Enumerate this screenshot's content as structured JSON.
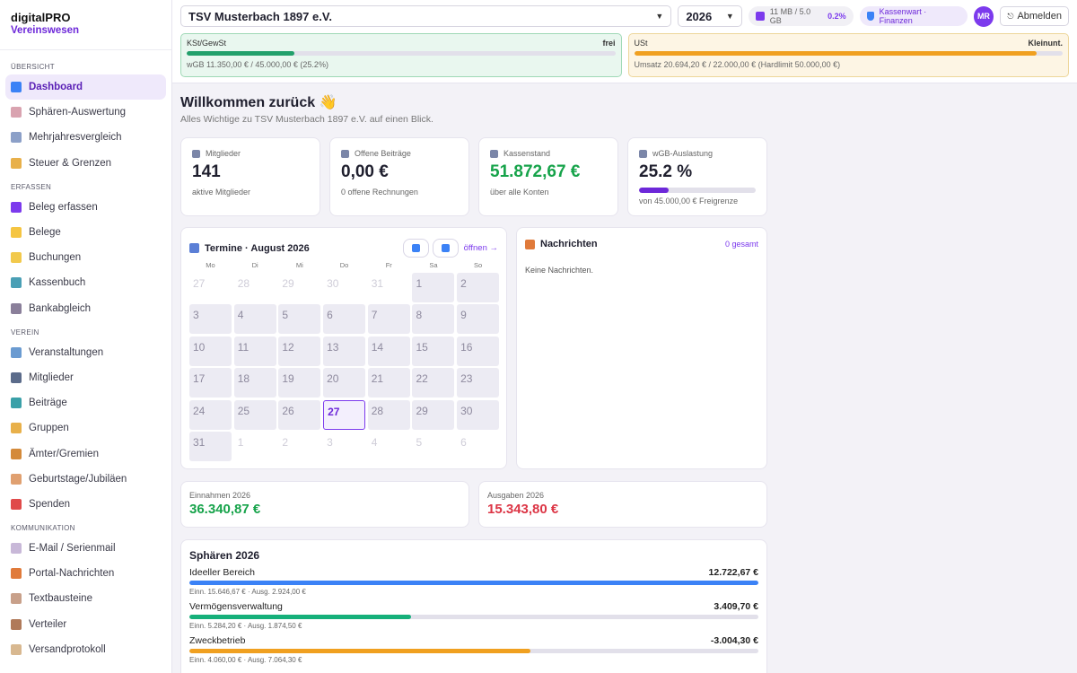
{
  "brand": {
    "name": "digitalPRO",
    "sub": "Vereinswesen"
  },
  "sidebar": {
    "sections": [
      {
        "label": "Übersicht",
        "items": [
          {
            "label": "Dashboard",
            "icon": "bar-chart-icon",
            "color": "#3b82f6",
            "active": true
          },
          {
            "label": "Sphären-Auswertung",
            "icon": "document-icon",
            "color": "#d9a3b0"
          },
          {
            "label": "Mehrjahresvergleich",
            "icon": "trend-icon",
            "color": "#8ca0c8"
          },
          {
            "label": "Steuer & Grenzen",
            "icon": "scale-icon",
            "color": "#e8b04a"
          }
        ]
      },
      {
        "label": "Erfassen",
        "items": [
          {
            "label": "Beleg erfassen",
            "icon": "plus-icon",
            "color": "#7c3aed"
          },
          {
            "label": "Belege",
            "icon": "folder-icon",
            "color": "#f5c542"
          },
          {
            "label": "Buchungen",
            "icon": "ledger-icon",
            "color": "#f2c94c"
          },
          {
            "label": "Kassenbuch",
            "icon": "cash-icon",
            "color": "#4a9fb5"
          },
          {
            "label": "Bankabgleich",
            "icon": "bank-icon",
            "color": "#8a7f9a"
          }
        ]
      },
      {
        "label": "Verein",
        "items": [
          {
            "label": "Veranstaltungen",
            "icon": "party-icon",
            "color": "#6b9bd1"
          },
          {
            "label": "Mitglieder",
            "icon": "members-icon",
            "color": "#5b6b8a"
          },
          {
            "label": "Beiträge",
            "icon": "money-icon",
            "color": "#3aa0a8"
          },
          {
            "label": "Gruppen",
            "icon": "tag-icon",
            "color": "#e8b04a"
          },
          {
            "label": "Ämter/Gremien",
            "icon": "medal-icon",
            "color": "#d48a3a"
          },
          {
            "label": "Geburtstage/Jubiläen",
            "icon": "cake-icon",
            "color": "#e0a070"
          },
          {
            "label": "Spenden",
            "icon": "gift-icon",
            "color": "#e04a4a"
          }
        ]
      },
      {
        "label": "Kommunikation",
        "items": [
          {
            "label": "E-Mail / Serienmail",
            "icon": "mail-icon",
            "color": "#c8b8d8"
          },
          {
            "label": "Portal-Nachrichten",
            "icon": "megaphone-icon",
            "color": "#e07a3a"
          },
          {
            "label": "Textbausteine",
            "icon": "memo-icon",
            "color": "#c8a08a"
          },
          {
            "label": "Verteiler",
            "icon": "clipboard-icon",
            "color": "#b07a5a"
          },
          {
            "label": "Versandprotokoll",
            "icon": "scroll-icon",
            "color": "#d8b890"
          }
        ]
      }
    ]
  },
  "topbar": {
    "club": "TSV Musterbach 1897 e.V.",
    "year": "2026",
    "storage": "11 MB / 5.0 GB",
    "storage_pct": "0.2%",
    "role": "Kassenwart · Finanzen",
    "avatar": "MR",
    "logout": "Abmelden"
  },
  "limits": [
    {
      "name": "KSt/GewSt",
      "status": "frei",
      "detail": "wGB 11.350,00 € / 45.000,00 € (25.2%)",
      "fraction": 0.252,
      "color": "#22a06b"
    },
    {
      "name": "USt",
      "status": "Kleinunt.",
      "detail": "Umsatz 20.694,20 € / 22.000,00 € (Hardlimit 50.000,00 €)",
      "fraction": 0.94,
      "color": "#f0a020"
    }
  ],
  "welcome": {
    "title": "Willkommen zurück 👋",
    "sub": "Alles Wichtige zu TSV Musterbach 1897 e.V. auf einen Blick."
  },
  "kpis": [
    {
      "label": "Mitglieder",
      "value": "141",
      "sub": "aktive Mitglieder",
      "color": "#1f1f2e",
      "icon": "members-icon"
    },
    {
      "label": "Offene Beiträge",
      "value": "0,00 €",
      "sub": "0 offene Rechnungen",
      "color": "#1f1f2e",
      "icon": "money-icon"
    },
    {
      "label": "Kassenstand",
      "value": "51.872,67 €",
      "sub": "über alle Konten",
      "color": "#16a34a",
      "icon": "bank-icon"
    },
    {
      "label": "wGB-Auslastung",
      "value": "25.2 %",
      "sub": "von 45.000,00 € Freigrenze",
      "color": "#1f1f2e",
      "icon": "party-icon",
      "fraction": 0.252
    }
  ],
  "calendar": {
    "title": "Termine · August 2026",
    "open": "öffnen →",
    "dows": [
      "Mo",
      "Di",
      "Mi",
      "Do",
      "Fr",
      "Sa",
      "So"
    ],
    "days": [
      {
        "d": "27",
        "t": "out"
      },
      {
        "d": "28",
        "t": "out"
      },
      {
        "d": "29",
        "t": "out"
      },
      {
        "d": "30",
        "t": "out"
      },
      {
        "d": "31",
        "t": "out"
      },
      {
        "d": "1",
        "t": "in"
      },
      {
        "d": "2",
        "t": "in"
      },
      {
        "d": "3",
        "t": "in"
      },
      {
        "d": "4",
        "t": "in"
      },
      {
        "d": "5",
        "t": "in"
      },
      {
        "d": "6",
        "t": "in"
      },
      {
        "d": "7",
        "t": "in"
      },
      {
        "d": "8",
        "t": "in"
      },
      {
        "d": "9",
        "t": "in"
      },
      {
        "d": "10",
        "t": "in"
      },
      {
        "d": "11",
        "t": "in"
      },
      {
        "d": "12",
        "t": "in"
      },
      {
        "d": "13",
        "t": "in"
      },
      {
        "d": "14",
        "t": "in"
      },
      {
        "d": "15",
        "t": "in"
      },
      {
        "d": "16",
        "t": "in"
      },
      {
        "d": "17",
        "t": "in"
      },
      {
        "d": "18",
        "t": "in"
      },
      {
        "d": "19",
        "t": "in"
      },
      {
        "d": "20",
        "t": "in"
      },
      {
        "d": "21",
        "t": "in"
      },
      {
        "d": "22",
        "t": "in"
      },
      {
        "d": "23",
        "t": "in"
      },
      {
        "d": "24",
        "t": "in"
      },
      {
        "d": "25",
        "t": "in"
      },
      {
        "d": "26",
        "t": "in"
      },
      {
        "d": "27",
        "t": "today"
      },
      {
        "d": "28",
        "t": "in"
      },
      {
        "d": "29",
        "t": "in"
      },
      {
        "d": "30",
        "t": "in"
      },
      {
        "d": "31",
        "t": "in"
      },
      {
        "d": "1",
        "t": "out"
      },
      {
        "d": "2",
        "t": "out"
      },
      {
        "d": "3",
        "t": "out"
      },
      {
        "d": "4",
        "t": "out"
      },
      {
        "d": "5",
        "t": "out"
      },
      {
        "d": "6",
        "t": "out"
      }
    ]
  },
  "news": {
    "title": "Nachrichten",
    "count": "0 gesamt",
    "empty": "Keine Nachrichten."
  },
  "totals": {
    "income": {
      "label": "Einnahmen 2026",
      "value": "36.340,87 €",
      "color": "#16a34a"
    },
    "expense": {
      "label": "Ausgaben 2026",
      "value": "15.343,80 €",
      "color": "#dc3545"
    }
  },
  "spheres": {
    "title": "Sphären 2026",
    "rows": [
      {
        "name": "Ideeller Bereich",
        "value": "12.722,67 €",
        "sub": "Einn. 15.646,67 € · Ausg. 2.924,00 €",
        "fraction": 1.0,
        "color": "#3b82f6"
      },
      {
        "name": "Vermögensverwaltung",
        "value": "3.409,70 €",
        "sub": "Einn. 5.284,20 € · Ausg. 1.874,50 €",
        "fraction": 0.39,
        "color": "#16b07a"
      },
      {
        "name": "Zweckbetrieb",
        "value": "-3.004,30 €",
        "sub": "Einn. 4.060,00 € · Ausg. 7.064,30 €",
        "fraction": 0.6,
        "color": "#f0a020"
      }
    ]
  }
}
